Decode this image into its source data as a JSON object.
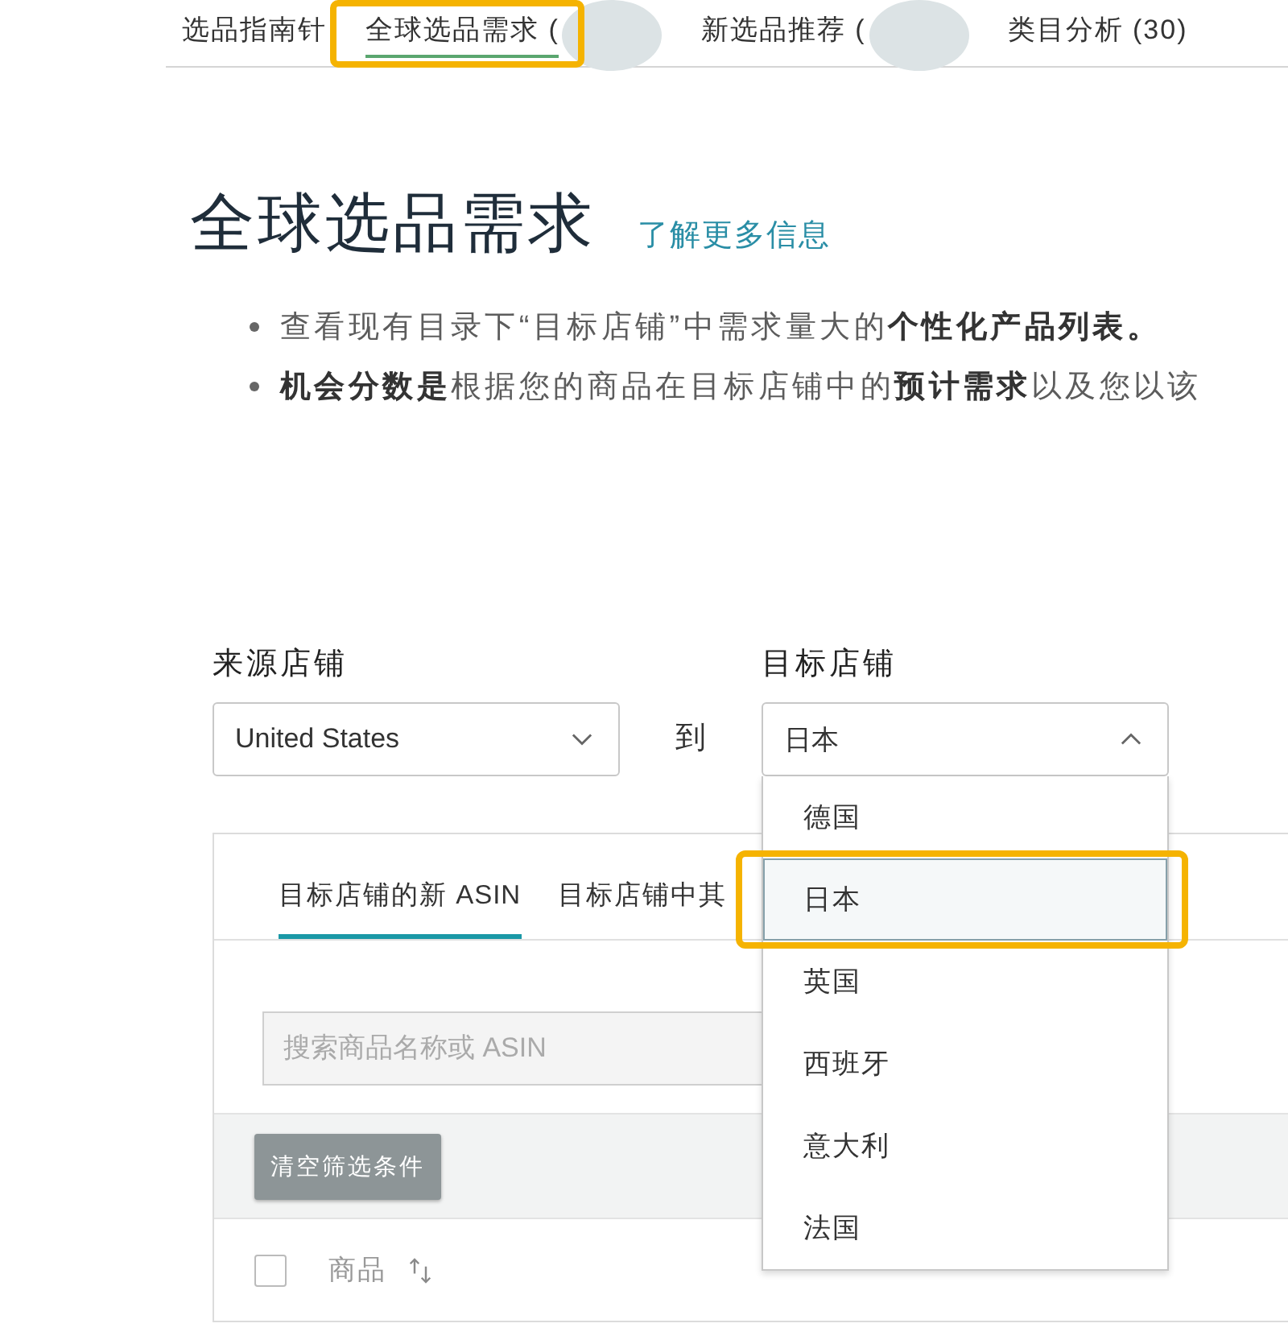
{
  "top_tabs": [
    {
      "label": "选品指南针",
      "selected": false,
      "highlighted": false,
      "redacted": false
    },
    {
      "label": "全球选品需求 (",
      "selected": true,
      "highlighted": true,
      "redacted": true
    },
    {
      "label": "新选品推荐 (",
      "selected": false,
      "highlighted": false,
      "redacted": true
    },
    {
      "label": "类目分析 (30)",
      "selected": false,
      "highlighted": false,
      "redacted": false
    }
  ],
  "header": {
    "title": "全球选品需求",
    "link": "了解更多信息",
    "bullets": [
      "查看现有目录下“目标店铺”中需求量大的**个性化产品列表。**",
      "**机会分数是**根据您的商品在目标店铺中的**预计需求**以及您以该"
    ]
  },
  "stores": {
    "source": {
      "label": "来源店铺",
      "value": "United States",
      "expanded": false
    },
    "connector": "到",
    "target": {
      "label": "目标店铺",
      "value": "日本",
      "expanded": true,
      "options": [
        {
          "label": "德国",
          "selected": false,
          "highlighted": false
        },
        {
          "label": "日本",
          "selected": true,
          "highlighted": true
        },
        {
          "label": "英国",
          "selected": false,
          "highlighted": false
        },
        {
          "label": "西班牙",
          "selected": false,
          "highlighted": false
        },
        {
          "label": "意大利",
          "selected": false,
          "highlighted": false
        },
        {
          "label": "法国",
          "selected": false,
          "highlighted": false
        }
      ]
    }
  },
  "panel": {
    "tabs": [
      {
        "label": "目标店铺的新 ASIN",
        "selected": true
      },
      {
        "label": "目标店铺中其",
        "selected": false
      }
    ],
    "search": {
      "placeholder": "搜索商品名称或 ASIN"
    },
    "clear_button": "清空筛选条件",
    "table_header": {
      "checked": false,
      "columns": [
        {
          "label": "商品",
          "sortable": true
        }
      ]
    }
  }
}
